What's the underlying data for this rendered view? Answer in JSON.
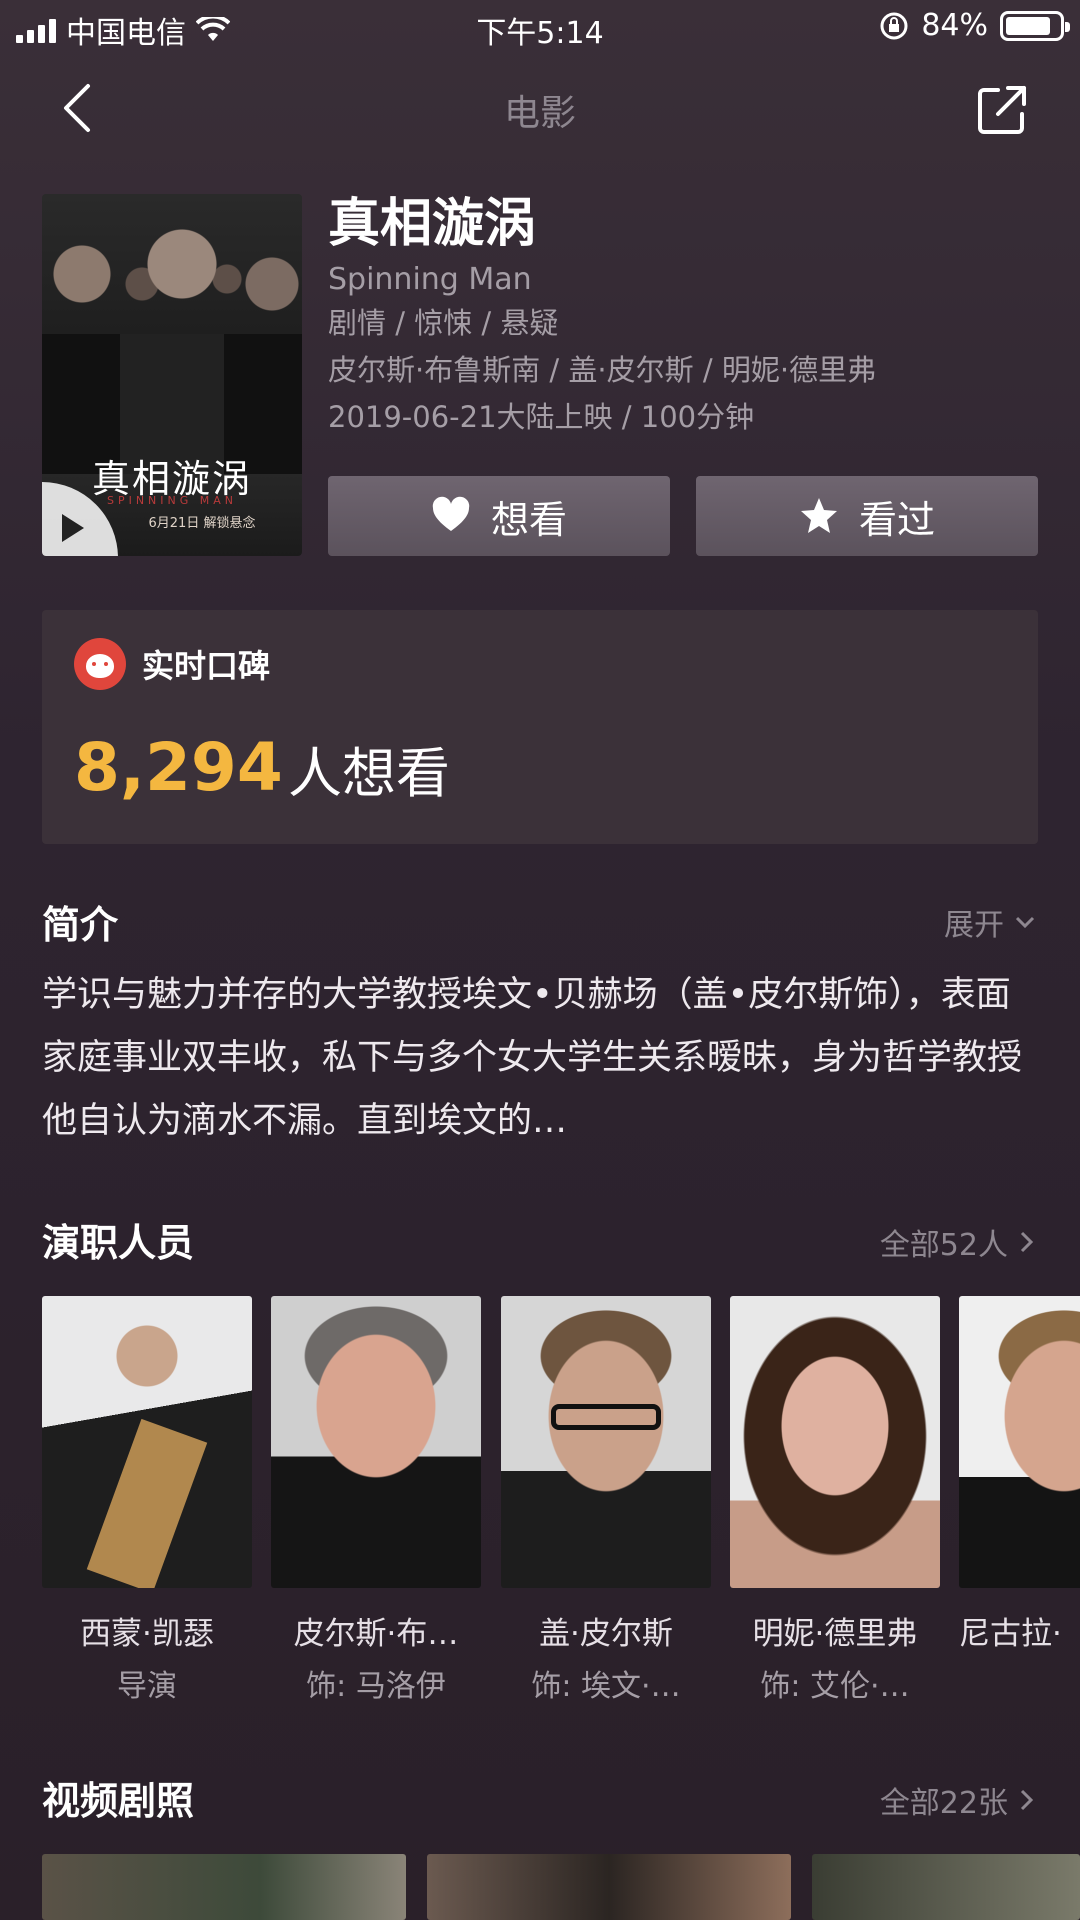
{
  "status_bar": {
    "carrier": "中国电信",
    "time": "下午5:14",
    "battery": "84%",
    "battery_level": 0.84
  },
  "nav": {
    "title": "电影"
  },
  "movie": {
    "title_cn": "真相漩涡",
    "title_en": "Spinning Man",
    "genres": "剧情 / 惊悚 / 悬疑",
    "cast_line": "皮尔斯·布鲁斯南 / 盖·皮尔斯 / 明妮·德里弗",
    "release": "2019-06-21大陆上映 / 100分钟",
    "poster_title": "真相漩涡",
    "poster_subtitle": "SPINNING MAN",
    "poster_date": "6月21日 解锁悬念"
  },
  "actions": {
    "want": "想看",
    "watched": "看过"
  },
  "rating": {
    "label": "实时口碑",
    "count": "8,294",
    "unit": "人想看"
  },
  "intro": {
    "title": "简介",
    "expand": "展开",
    "text": "学识与魅力并存的大学教授埃文•贝赫场（盖•皮尔斯饰），表面家庭事业双丰收，私下与多个女大学生关系暧昧，身为哲学教授他自认为滴水不漏。直到埃文的…"
  },
  "cast_section": {
    "title": "演职人员",
    "more": "全部52人",
    "members": [
      {
        "name": "西蒙·凯瑟",
        "role": "导演"
      },
      {
        "name": "皮尔斯·布…",
        "role": "饰: 马洛伊"
      },
      {
        "name": "盖·皮尔斯",
        "role": "饰: 埃文·…"
      },
      {
        "name": "明妮·德里弗",
        "role": "饰: 艾伦·…"
      },
      {
        "name": "尼古拉·",
        "role": ""
      }
    ]
  },
  "stills_section": {
    "title": "视频剧照",
    "more": "全部22张"
  },
  "colors": {
    "background": "#2e2430",
    "accent_count": "#f4b740",
    "card": "#3b3139",
    "button": "#665c67",
    "maoyan_red": "#e0463c"
  }
}
